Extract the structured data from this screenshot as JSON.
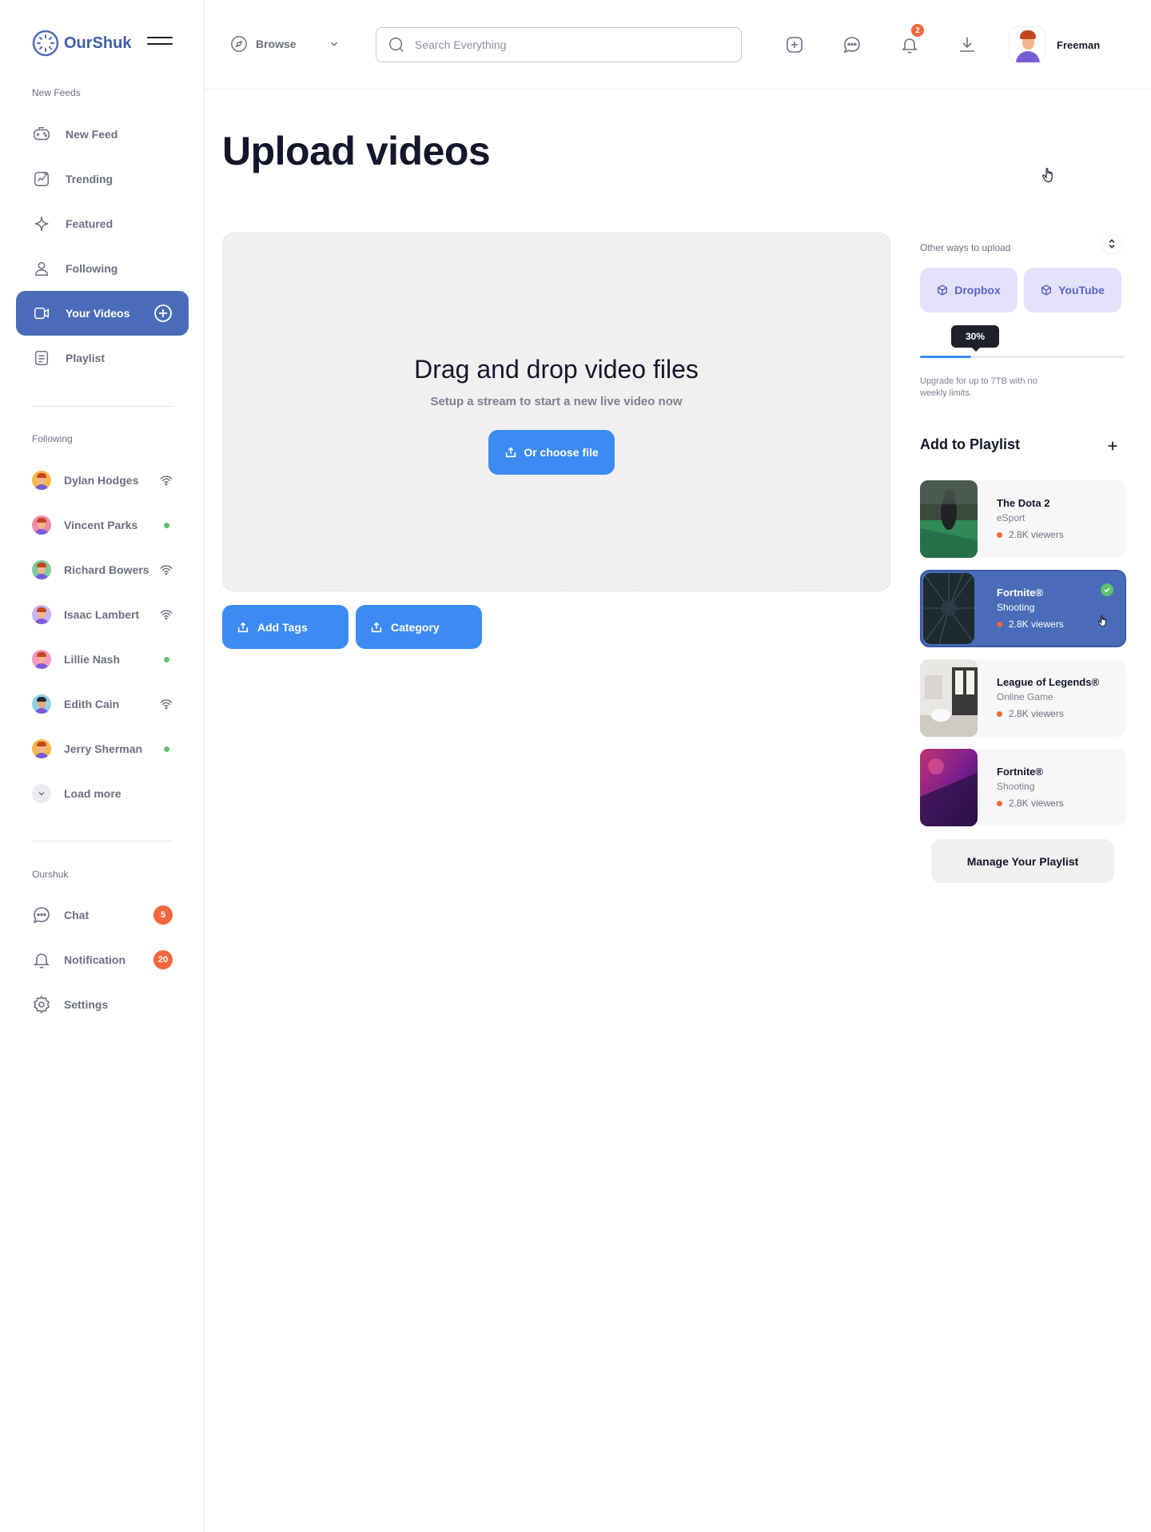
{
  "app": {
    "name": "OurShuk",
    "brand_color": "#4a6cb8",
    "accent_color": "#3d8bf2"
  },
  "sidebar": {
    "section_feeds": "New Feeds",
    "nav": [
      {
        "label": "New Feed",
        "icon": "gamepad-icon"
      },
      {
        "label": "Trending",
        "icon": "trending-chart-icon"
      },
      {
        "label": "Featured",
        "icon": "sparkle-icon"
      },
      {
        "label": "Following",
        "icon": "user-icon"
      },
      {
        "label": "Your Videos",
        "icon": "video-icon",
        "active": true
      },
      {
        "label": "Playlist",
        "icon": "list-icon"
      }
    ],
    "section_following": "Following",
    "following": [
      {
        "name": "Dylan Hodges",
        "status": "live",
        "avatar_bg": "#f5b94a"
      },
      {
        "name": "Vincent Parks",
        "status": "online",
        "avatar_bg": "#f08aa8"
      },
      {
        "name": "Richard Bowers",
        "status": "live",
        "avatar_bg": "#7fc99a"
      },
      {
        "name": "Isaac Lambert",
        "status": "live",
        "avatar_bg": "#c7b3f5"
      },
      {
        "name": "Lillie Nash",
        "status": "online",
        "avatar_bg": "#f39ac2"
      },
      {
        "name": "Edith Cain",
        "status": "live",
        "avatar_bg": "#8fd2e8"
      },
      {
        "name": "Jerry Sherman",
        "status": "online",
        "avatar_bg": "#f5b94a"
      }
    ],
    "load_more": "Load more",
    "section_ourshuk": "Ourshuk",
    "bottom": [
      {
        "label": "Chat",
        "icon": "chat-bubble-icon",
        "badge": "5"
      },
      {
        "label": "Notification",
        "icon": "bell-icon",
        "badge": "20"
      },
      {
        "label": "Settings",
        "icon": "gear-icon"
      }
    ]
  },
  "header": {
    "browse_label": "Browse",
    "search_placeholder": "Search Everything",
    "notification_count": "2",
    "user_name": "Freeman"
  },
  "main": {
    "title": "Upload videos",
    "dropzone_title": "Drag and drop video files",
    "dropzone_subtitle": "Setup a stream to start a new live video now",
    "choose_file_label": "Or choose file",
    "add_tags_label": "Add Tags",
    "category_label": "Category"
  },
  "right_panel": {
    "other_ways_label": "Other ways to upload",
    "sources": [
      "Dropbox",
      "YouTube"
    ],
    "progress_percent": 30,
    "progress_label": "30%",
    "upgrade_text": "Upgrade for up to 7TB with no weekly limits.",
    "playlist_title": "Add to Playlist",
    "playlist": [
      {
        "name": "The Dota 2",
        "category": "eSport",
        "viewers": "2.8K viewers",
        "selected": false,
        "thumb": "dota"
      },
      {
        "name": "Fortnite®",
        "category": "Shooting",
        "viewers": "2.8K viewers",
        "selected": true,
        "thumb": "fortnite-dark"
      },
      {
        "name": "League of Legends®",
        "category": "Online Game",
        "viewers": "2.8K viewers",
        "selected": false,
        "thumb": "lol"
      },
      {
        "name": "Fortnite®",
        "category": "Shooting",
        "viewers": "2.8K viewers",
        "selected": false,
        "thumb": "fortnite-purple"
      }
    ],
    "manage_label": "Manage Your Playlist"
  }
}
